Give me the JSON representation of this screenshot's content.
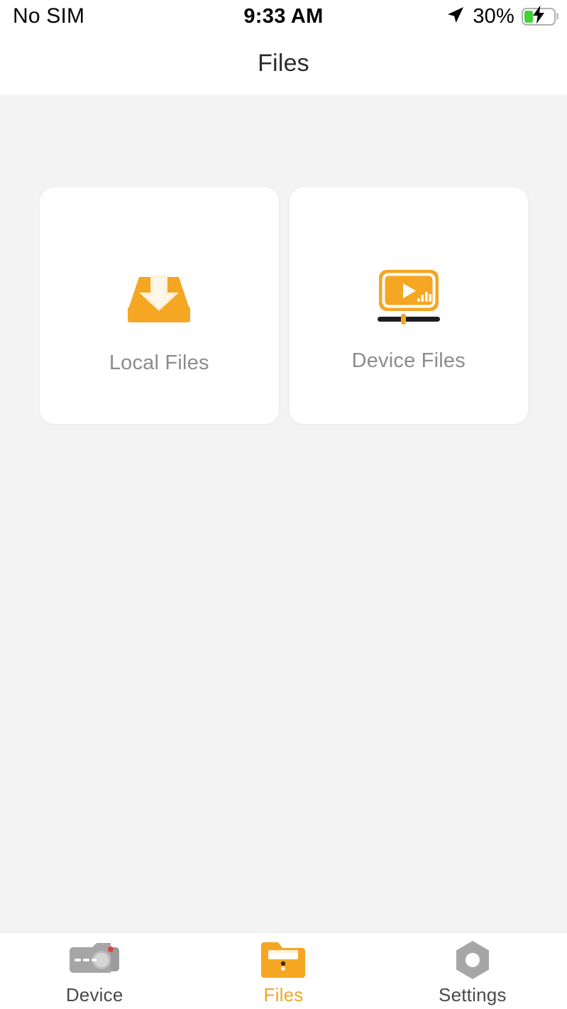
{
  "status_bar": {
    "carrier": "No SIM",
    "time": "9:33 AM",
    "battery_percent": "30%",
    "battery_level": 30,
    "charging": true,
    "location_icon": "location-arrow-icon",
    "battery_icon": "battery-charging-icon"
  },
  "header": {
    "title": "Files"
  },
  "main": {
    "cards": [
      {
        "label": "Local Files",
        "icon": "inbox-download-icon"
      },
      {
        "label": "Device Files",
        "icon": "video-player-icon"
      }
    ]
  },
  "tab_bar": {
    "tabs": [
      {
        "label": "Device",
        "icon": "dashcam-icon",
        "active": false
      },
      {
        "label": "Files",
        "icon": "folder-icon",
        "active": true
      },
      {
        "label": "Settings",
        "icon": "hex-nut-icon",
        "active": false
      }
    ]
  },
  "colors": {
    "accent": "#f5a623",
    "accent_dark": "#f0a62a",
    "icon_gray": "#a6a6a6",
    "label_gray": "#8c8c8c",
    "battery_green": "#3ed337",
    "background": "#f3f3f3",
    "card": "#ffffff"
  }
}
